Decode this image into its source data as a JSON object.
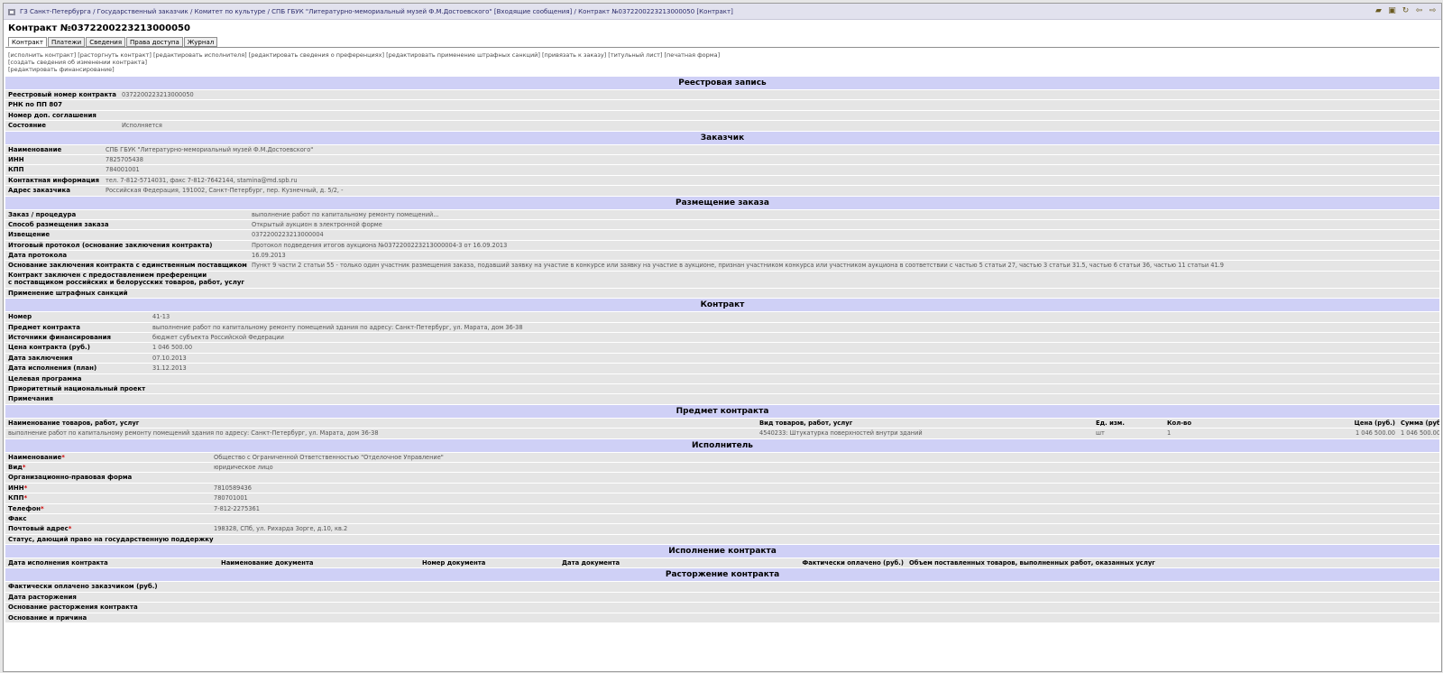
{
  "breadcrumb": [
    "ГЗ Санкт-Петербурга",
    "Государственный заказчик",
    "Комитет по культуре",
    "СПБ ГБУК \"Литературно-мемориальный музей Ф.М.Достоевского\" [Входящие сообщения]",
    "Контракт №0372200223213000050 [Контракт]"
  ],
  "page_title": "Контракт №0372200223213000050",
  "tabs": [
    "Контракт",
    "Платежи",
    "Сведения",
    "Права доступа",
    "Журнал"
  ],
  "actions": [
    [
      "[исполнить контракт]",
      "[расторгнуть контракт]",
      "[редактировать исполнителя]",
      "[редактировать сведения о преференциях]",
      "[редактировать применение штрафных санкций]",
      "[привязать к заказу]",
      "[титульный лист]",
      "[печатная форма]"
    ],
    [
      "[создать сведения об изменении контракта]"
    ],
    [
      "[редактировать финансирование]"
    ]
  ],
  "sec_registry": {
    "title": "Реестровая запись",
    "rows": [
      {
        "label": "Реестровый номер контракта",
        "value": "0372200223213000050"
      },
      {
        "label": "РНК по ПП 807",
        "value": ""
      },
      {
        "label": "Номер доп. соглашения",
        "value": ""
      },
      {
        "label": "Состояние",
        "value": "Исполняется"
      }
    ]
  },
  "sec_customer": {
    "title": "Заказчик",
    "rows": [
      {
        "label": "Наименование",
        "value": "СПБ ГБУК \"Литературно-мемориальный музей Ф.М.Достоевского\""
      },
      {
        "label": "ИНН",
        "value": "7825705438"
      },
      {
        "label": "КПП",
        "value": "784001001"
      },
      {
        "label": "Контактная информация",
        "value": "тел. 7-812-5714031, факс 7-812-7642144, stamina@md.spb.ru"
      },
      {
        "label": "Адрес заказчика",
        "value": "Российская Федерация, 191002, Санкт-Петербург, пер. Кузнечный, д. 5/2, -"
      }
    ]
  },
  "sec_placement": {
    "title": "Размещение заказа",
    "rows": [
      {
        "label": "Заказ / процедура",
        "value": "выполнение работ по капитальному ремонту помещений..."
      },
      {
        "label": "Способ размещения заказа",
        "value": "Открытый аукцион в электронной форме"
      },
      {
        "label": "Извещение",
        "value": "0372200223213000004"
      },
      {
        "label": "Итоговый протокол (основание заключения контракта)",
        "value": "Протокол подведения итогов аукциона №0372200223213000004-3 от 16.09.2013"
      },
      {
        "label": "Дата протокола",
        "value": "16.09.2013"
      },
      {
        "label": "Основание заключения контракта с единственным поставщиком",
        "value": "Пункт 9 части 2 статьи 55 - только один участник размещения заказа, подавший заявку на участие в конкурсе или заявку на участие в аукционе, признан участником конкурса или участником аукциона в соответствии с частью 5 статьи 27, частью 3 статьи 31.5, частью 6 статьи 36, частью 11 статьи 41.9"
      },
      {
        "label": "Контракт заключен с предоставлением преференции\nс поставщиком российских и белорусских товаров, работ, услуг",
        "value": ""
      },
      {
        "label": "Применение штрафных санкций",
        "value": ""
      }
    ]
  },
  "sec_contract": {
    "title": "Контракт",
    "rows": [
      {
        "label": "Номер",
        "value": "41-13"
      },
      {
        "label": "Предмет контракта",
        "value": "выполнение работ по капитальному ремонту помещений здания по адресу: Санкт-Петербург, ул. Марата, дом 36-38"
      },
      {
        "label": "Источники финансирования",
        "value": "бюджет субъекта Российской Федерации"
      },
      {
        "label": "Цена контракта (руб.)",
        "value": "1 046 500.00"
      },
      {
        "label": "Дата заключения",
        "value": "07.10.2013"
      },
      {
        "label": "Дата исполнения (план)",
        "value": "31.12.2013"
      },
      {
        "label": "Целевая программа",
        "value": ""
      },
      {
        "label": "Приоритетный национальный проект",
        "value": ""
      },
      {
        "label": "Примечания",
        "value": ""
      }
    ]
  },
  "sec_subject": {
    "title": "Предмет контракта",
    "headers": [
      "Наименование товаров, работ, услуг",
      "Вид товаров, работ, услуг",
      "Ед. изм.",
      "Кол-во",
      "Цена (руб.)",
      "Сумма (руб.)"
    ],
    "row": [
      "выполнение работ по капитальному ремонту помещений здания по адресу: Санкт-Петербург, ул. Марата, дом 36-38",
      "4540233: Штукатурка поверхностей внутри зданий",
      "шт",
      "1",
      "1 046 500.00",
      "1 046 500.00"
    ]
  },
  "sec_executor": {
    "title": "Исполнитель",
    "rows": [
      {
        "label": "Наименование",
        "req": true,
        "value": "Общество с Ограниченной Ответственностью \"Отделочное Управление\""
      },
      {
        "label": "Вид",
        "req": true,
        "value": "юридическое лицо"
      },
      {
        "label": "Организационно-правовая форма",
        "req": false,
        "value": ""
      },
      {
        "label": "ИНН",
        "req": true,
        "value": "7810589436"
      },
      {
        "label": "КПП",
        "req": true,
        "value": "780701001"
      },
      {
        "label": "Телефон",
        "req": true,
        "value": "7-812-2275361"
      },
      {
        "label": "Факс",
        "req": false,
        "value": ""
      },
      {
        "label": "Почтовый адрес",
        "req": true,
        "value": "198328, СПб, ул. Рихарда Зорге, д.10, кв.2"
      },
      {
        "label": "Статус, дающий право на государственную поддержку",
        "req": false,
        "value": ""
      }
    ]
  },
  "sec_execution": {
    "title": "Исполнение контракта",
    "headers": [
      "Дата исполнения контракта",
      "Наименование документа",
      "Номер документа",
      "Дата документа",
      "Фактически оплачено (руб.)",
      "Объем поставленных товаров, выполненных работ, оказанных услуг"
    ]
  },
  "sec_termination": {
    "title": "Расторжение контракта",
    "rows": [
      {
        "label": "Фактически оплачено заказчиком (руб.)",
        "value": ""
      },
      {
        "label": "Дата расторжения",
        "value": ""
      },
      {
        "label": "Основание расторжения контракта",
        "value": ""
      },
      {
        "label": "Основание и причина",
        "value": ""
      }
    ]
  },
  "icons": [
    "home-icon",
    "folder-icon",
    "lock-icon",
    "refresh-icon",
    "back-icon",
    "forward-icon"
  ]
}
